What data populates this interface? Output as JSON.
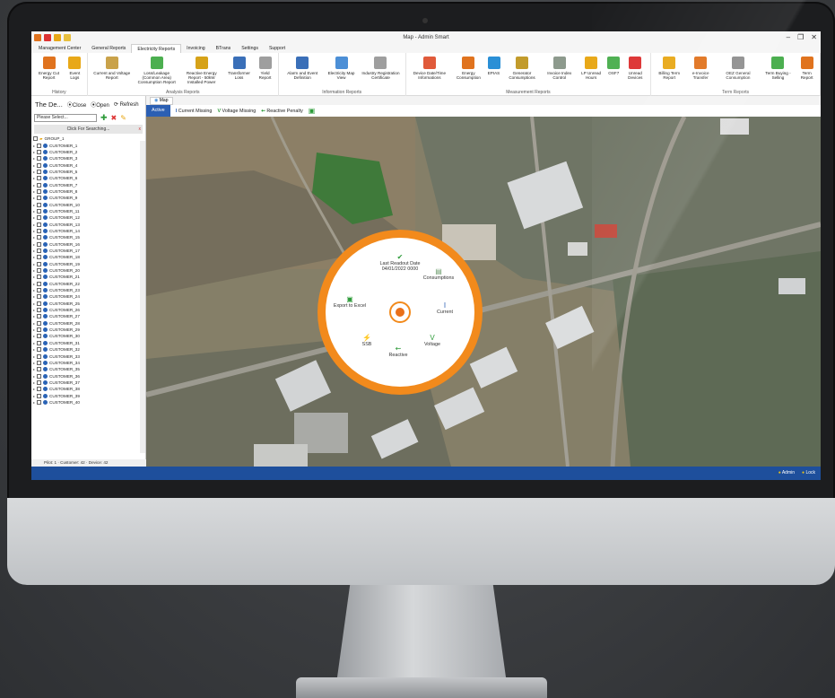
{
  "window": {
    "title": "Map - Admin Smart",
    "controls": [
      "–",
      "❐",
      "✕"
    ]
  },
  "tabs": [
    "Management Center",
    "General Reports",
    "Electricity Reports",
    "Invoicing",
    "BTrans",
    "Settings",
    "Support"
  ],
  "active_tab": "Electricity Reports",
  "ribbon": {
    "groups": [
      {
        "name": "History",
        "buttons": [
          {
            "label": "Energy Cut Report",
            "color": "#e0731e"
          },
          {
            "label": "Event Logs",
            "color": "#e8a818"
          }
        ]
      },
      {
        "name": "Analysis Reports",
        "buttons": [
          {
            "label": "Current and Voltage Report",
            "color": "#c9a24a"
          },
          {
            "label": "Loss/Leakage (Common Area) Consumption Report",
            "color": "#4caf50"
          },
          {
            "label": "Reactive Energy Report - 50kW Installed Power",
            "color": "#d6a218"
          },
          {
            "label": "Transformer Loss",
            "color": "#3a6fb8"
          },
          {
            "label": "Yield Report",
            "color": "#9e9e9e"
          }
        ]
      },
      {
        "name": "Information Reports",
        "buttons": [
          {
            "label": "Alarm and Event Definition",
            "color": "#3a6fb8"
          },
          {
            "label": "Electricity Map View",
            "color": "#4c8fd6"
          },
          {
            "label": "Industry Registration Certificate",
            "color": "#9e9e9e"
          }
        ]
      },
      {
        "name": "Measurement Reports",
        "buttons": [
          {
            "label": "Device Date/Time Informations",
            "color": "#e05a3a"
          },
          {
            "label": "Energy Consumption",
            "color": "#e0731e"
          },
          {
            "label": "EPIAS",
            "color": "#2a8fd6"
          },
          {
            "label": "Generator Consumptions",
            "color": "#c29b2b"
          },
          {
            "label": "Invoice Index Control",
            "color": "#8d9a8d"
          },
          {
            "label": "LP Unread Hours",
            "color": "#e8a818"
          },
          {
            "label": "OSF7",
            "color": "#4caf50"
          },
          {
            "label": "Unread Devices",
            "color": "#d33"
          }
        ]
      },
      {
        "name": "Term Reports",
        "buttons": [
          {
            "label": "Billing Term Report",
            "color": "#e8a818"
          },
          {
            "label": "e-Invoice Transfer",
            "color": "#e0731e"
          },
          {
            "label": "OEZ General Consumption",
            "color": "#8d8d8d"
          },
          {
            "label": "Term Buying - Selling",
            "color": "#4caf50"
          },
          {
            "label": "Term Report",
            "color": "#e0731e"
          }
        ]
      }
    ]
  },
  "left_panel": {
    "title": "The De...",
    "actions": [
      "⦿Close",
      "⦿Open",
      "⟳ Refresh"
    ],
    "select_placeholder": "Please Select...",
    "search_label": "Click For Searching...",
    "group": "GROUP_1",
    "customers": [
      "CUSTOMER_1",
      "CUSTOMER_2",
      "CUSTOMER_3",
      "CUSTOMER_4",
      "CUSTOMER_5",
      "CUSTOMER_6",
      "CUSTOMER_7",
      "CUSTOMER_8",
      "CUSTOMER_9",
      "CUSTOMER_10",
      "CUSTOMER_11",
      "CUSTOMER_12",
      "CUSTOMER_13",
      "CUSTOMER_14",
      "CUSTOMER_15",
      "CUSTOMER_16",
      "CUSTOMER_17",
      "CUSTOMER_18",
      "CUSTOMER_19",
      "CUSTOMER_20",
      "CUSTOMER_21",
      "CUSTOMER_22",
      "CUSTOMER_23",
      "CUSTOMER_24",
      "CUSTOMER_25",
      "CUSTOMER_26",
      "CUSTOMER_27",
      "CUSTOMER_28",
      "CUSTOMER_29",
      "CUSTOMER_30",
      "CUSTOMER_31",
      "CUSTOMER_32",
      "CUSTOMER_33",
      "CUSTOMER_34",
      "CUSTOMER_35",
      "CUSTOMER_36",
      "CUSTOMER_37",
      "CUSTOMER_38",
      "CUSTOMER_39",
      "CUSTOMER_40"
    ],
    "status": "Pilot: 1  ·  Customer: 42  ·  Device: 42"
  },
  "map": {
    "tab_label": "Map",
    "filters": [
      {
        "label": "Active",
        "icon": ""
      },
      {
        "label": "Current Missing",
        "icon": "I"
      },
      {
        "label": "Voltage Missing",
        "icon": "V"
      },
      {
        "label": "Reactive Penalty",
        "icon": "⇜"
      }
    ]
  },
  "radial_menu": {
    "last_readout_label": "Last Readout Date",
    "last_readout_value": "04/01/2022 0000",
    "items": {
      "consumptions": "Consumptions",
      "export": "Export to Excel",
      "current": "Current",
      "ssb": "SSB",
      "voltage": "Voltage",
      "reactive": "Reactive"
    }
  },
  "statusbar": {
    "user": "Admin",
    "lock": "Lock"
  },
  "colors": {
    "accent": "#f28a1c",
    "brand_blue": "#2b5fb3"
  }
}
